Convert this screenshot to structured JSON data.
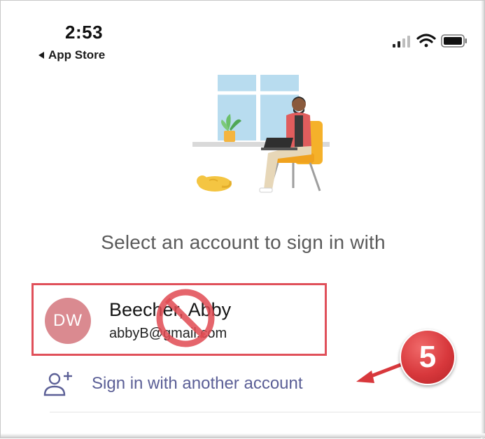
{
  "status_bar": {
    "time": "2:53",
    "back_label": "App Store"
  },
  "prompt": "Select an account to sign in with",
  "account": {
    "initials": "DW",
    "name": "Beecher, Abby",
    "email": "abbyB@gmail.com"
  },
  "sign_in_another": {
    "label": "Sign in with another account"
  },
  "annotation": {
    "step_number": "5"
  },
  "colors": {
    "highlight_border": "#e0505a",
    "avatar_bg": "#da8a90",
    "link_text": "#5b5f96",
    "callout": "#d8383c"
  },
  "icons": [
    "back-arrow-icon",
    "signal-icon",
    "wifi-icon",
    "battery-icon",
    "no-entry-icon",
    "add-user-icon",
    "callout-arrow-icon"
  ]
}
